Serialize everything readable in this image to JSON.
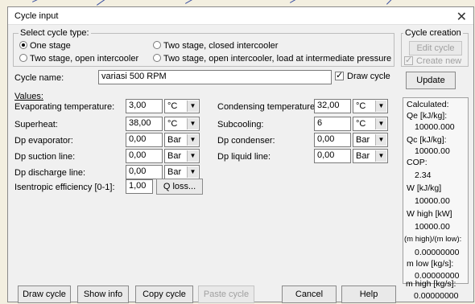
{
  "dialog": {
    "title": "Cycle input"
  },
  "cycle_type": {
    "group_label": "Select cycle type:",
    "options": [
      {
        "label": "One stage",
        "selected": true
      },
      {
        "label": "Two stage, closed intercooler",
        "selected": false
      },
      {
        "label": "Two stage, open intercooler",
        "selected": false
      },
      {
        "label": "Two stage, open intercooler, load at intermediate pressure",
        "selected": false
      }
    ]
  },
  "cycle_creation": {
    "group_label": "Cycle creation",
    "edit_label": "Edit cycle",
    "create_new_label": "Create new",
    "create_new_checked": true
  },
  "cycle_name": {
    "label": "Cycle name:",
    "value": "variasi 500 RPM"
  },
  "draw_cycle": {
    "label": "Draw cycle",
    "checked": true
  },
  "update_label": "Update",
  "values_label": "Values:",
  "fields": {
    "evap_temp": {
      "label": "Evaporating temperature:",
      "value": "3,00",
      "unit": "°C"
    },
    "superheat": {
      "label": "Superheat:",
      "value": "38,00",
      "unit": "°C"
    },
    "dp_evap": {
      "label": "Dp evaporator:",
      "value": "0,00",
      "unit": "Bar"
    },
    "dp_suction": {
      "label": "Dp suction line:",
      "value": "0,00",
      "unit": "Bar"
    },
    "dp_discharge": {
      "label": "Dp discharge line:",
      "value": "0,00",
      "unit": "Bar"
    },
    "isentropic": {
      "label": "Isentropic efficiency [0-1]:",
      "value": "1,00"
    },
    "cond_temp": {
      "label": "Condensing temperature:",
      "value": "32,00",
      "unit": "°C"
    },
    "subcooling": {
      "label": "Subcooling:",
      "value": "6",
      "unit": "°C"
    },
    "dp_cond": {
      "label": "Dp condenser:",
      "value": "0,00",
      "unit": "Bar"
    },
    "dp_liquid": {
      "label": "Dp liquid line:",
      "value": "0,00",
      "unit": "Bar"
    }
  },
  "q_loss_label": "Q loss...",
  "calculated": {
    "label": "Calculated:",
    "items": [
      {
        "label": "Qe [kJ/kg]:",
        "value": "10000.000"
      },
      {
        "label": "Qc [kJ/kg]:",
        "value": "10000.00"
      },
      {
        "label": "COP:",
        "value": "2.34"
      },
      {
        "label": "W  [kJ/kg]",
        "value": "10000.00"
      },
      {
        "label": "W high [kW]",
        "value": "10000.00"
      },
      {
        "label": "(m high)/(m low):",
        "value": "0.00000000"
      },
      {
        "label": "m low [kg/s]:",
        "value": "0.00000000"
      },
      {
        "label": "m high [kg/s]:",
        "value": "0.00000000"
      }
    ]
  },
  "bottom_buttons": {
    "draw_cycle": "Draw cycle",
    "show_info": "Show info",
    "copy_cycle": "Copy cycle",
    "paste_cycle": "Paste cycle",
    "cancel": "Cancel",
    "help": "Help"
  },
  "colors": {
    "dialog_bg": "#f0f0f0",
    "chart_line": "#3a4fa0",
    "accent_line": "#cc3333"
  }
}
